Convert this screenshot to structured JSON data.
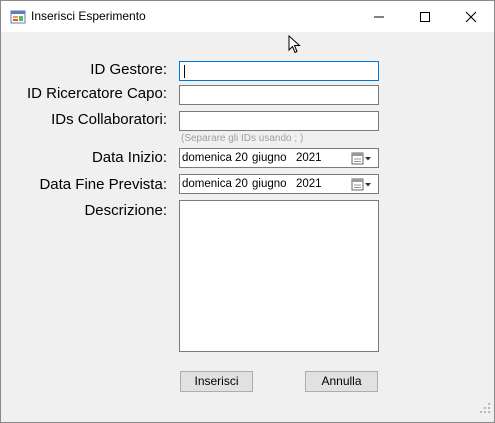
{
  "window": {
    "title": "Inserisci Esperimento",
    "icon": "form-app-icon",
    "controls": {
      "minimize": "minimize-icon",
      "maximize": "maximize-icon",
      "close": "close-icon"
    }
  },
  "form": {
    "id_gestore_label": "ID Gestore:",
    "id_gestore_value": "",
    "id_ricercatore_label": "ID Ricercatore Capo:",
    "id_ricercatore_value": "",
    "id_collaboratori_label": "IDs Collaboratori:",
    "id_collaboratori_value": "",
    "id_collaboratori_hint": "(Separare gli IDs usando ; )",
    "data_inizio_label": "Data Inizio:",
    "data_inizio": {
      "day": "domenica 20",
      "month": "giugno",
      "year": "2021"
    },
    "data_fine_label": "Data Fine Prevista:",
    "data_fine": {
      "day": "domenica 20",
      "month": "giugno",
      "year": "2021"
    },
    "descrizione_label": "Descrizione:",
    "descrizione_value": ""
  },
  "buttons": {
    "insert": "Inserisci",
    "cancel": "Annulla"
  },
  "colors": {
    "window_bg": "#f0f0f0",
    "focus_border": "#0078d7",
    "hint_text": "#a0a0a0"
  }
}
